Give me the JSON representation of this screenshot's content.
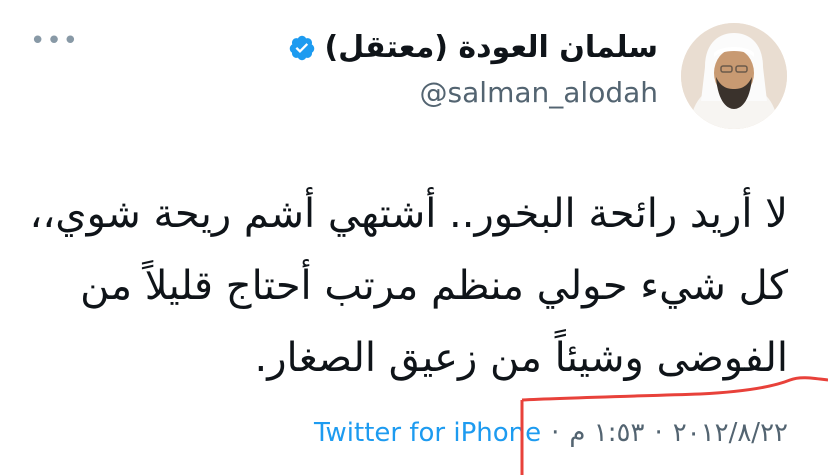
{
  "more_icon": "more-horizontal-icon",
  "author": {
    "display_name": "سلمان العودة (معتقل)",
    "handle": "@salman_alodah",
    "verified_icon": "verified-badge-icon",
    "avatar_icon": "profile-photo"
  },
  "tweet": {
    "lines": [
      "لا أريد رائحة البخور.. أشتهي أشم ريحة شوي،،",
      "كل شيء حولي منظم مرتب أحتاج قليلاً من",
      "الفوضى وشيئاً من زعيق الصغار."
    ]
  },
  "meta": {
    "date": "٢٠١٢/٨/٢٢",
    "separator": "·",
    "time": "١:٥٣ م",
    "source": "Twitter for iPhone"
  },
  "colors": {
    "text": "#0f1419",
    "secondary": "#536471",
    "link": "#1d9bf0",
    "annotation": "#e8413a"
  }
}
